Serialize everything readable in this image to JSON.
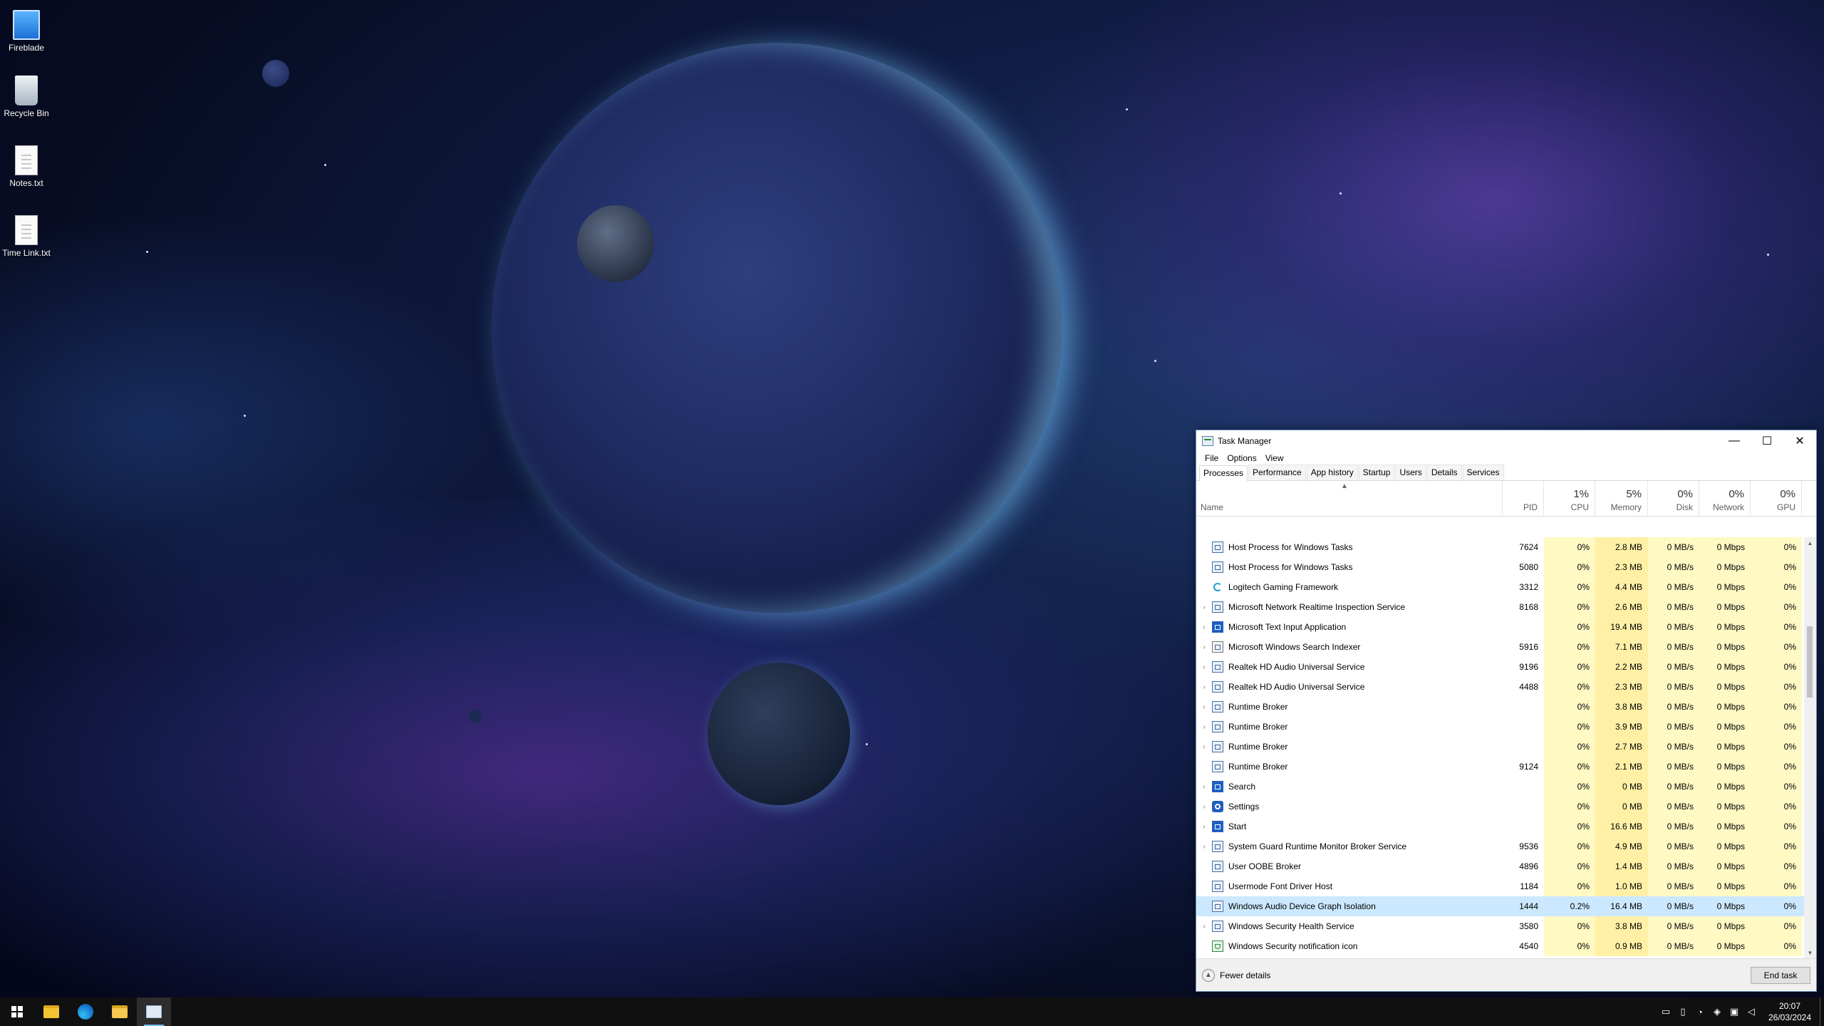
{
  "desktop": {
    "icons": [
      {
        "label": "Fireblade",
        "icon": "computer-icon"
      },
      {
        "label": "Recycle Bin",
        "icon": "recycle-bin-icon"
      },
      {
        "label": "Notes.txt",
        "icon": "text-file-icon"
      },
      {
        "label": "Time Link.txt",
        "icon": "text-file-icon"
      }
    ]
  },
  "task_manager": {
    "title": "Task Manager",
    "window_controls": {
      "minimize": "—",
      "maximize": "☐",
      "close": "✕"
    },
    "menu": [
      "File",
      "Options",
      "View"
    ],
    "tabs": [
      "Processes",
      "Performance",
      "App history",
      "Startup",
      "Users",
      "Details",
      "Services"
    ],
    "active_tab": "Processes",
    "columns": {
      "name": "Name",
      "pid": "PID",
      "cpu": {
        "label": "CPU",
        "total": "1%"
      },
      "memory": {
        "label": "Memory",
        "total": "5%"
      },
      "disk": {
        "label": "Disk",
        "total": "0%"
      },
      "network": {
        "label": "Network",
        "total": "0%"
      },
      "gpu": {
        "label": "GPU",
        "total": "0%"
      }
    },
    "rows": [
      {
        "name": "Host Process for Windows Tasks",
        "pid": "7624",
        "cpu": "0%",
        "memory": "2.8 MB",
        "disk": "0 MB/s",
        "network": "0 Mbps",
        "gpu": "0%",
        "expandable": false,
        "icon": "service-icon"
      },
      {
        "name": "Host Process for Windows Tasks",
        "pid": "5080",
        "cpu": "0%",
        "memory": "2.3 MB",
        "disk": "0 MB/s",
        "network": "0 Mbps",
        "gpu": "0%",
        "expandable": false,
        "icon": "service-icon"
      },
      {
        "name": "Logitech Gaming Framework",
        "pid": "3312",
        "cpu": "0%",
        "memory": "4.4 MB",
        "disk": "0 MB/s",
        "network": "0 Mbps",
        "gpu": "0%",
        "expandable": false,
        "icon": "logitech-icon"
      },
      {
        "name": "Microsoft Network Realtime Inspection Service",
        "pid": "8168",
        "cpu": "0%",
        "memory": "2.6 MB",
        "disk": "0 MB/s",
        "network": "0 Mbps",
        "gpu": "0%",
        "expandable": true,
        "icon": "service-icon"
      },
      {
        "name": "Microsoft Text Input Application",
        "pid": "",
        "cpu": "0%",
        "memory": "19.4 MB",
        "disk": "0 MB/s",
        "network": "0 Mbps",
        "gpu": "0%",
        "expandable": true,
        "icon": "app-icon"
      },
      {
        "name": "Microsoft Windows Search Indexer",
        "pid": "5916",
        "cpu": "0%",
        "memory": "7.1 MB",
        "disk": "0 MB/s",
        "network": "0 Mbps",
        "gpu": "0%",
        "expandable": true,
        "icon": "search-indexer-icon"
      },
      {
        "name": "Realtek HD Audio Universal Service",
        "pid": "9196",
        "cpu": "0%",
        "memory": "2.2 MB",
        "disk": "0 MB/s",
        "network": "0 Mbps",
        "gpu": "0%",
        "expandable": true,
        "icon": "service-icon"
      },
      {
        "name": "Realtek HD Audio Universal Service",
        "pid": "4488",
        "cpu": "0%",
        "memory": "2.3 MB",
        "disk": "0 MB/s",
        "network": "0 Mbps",
        "gpu": "0%",
        "expandable": true,
        "icon": "service-icon"
      },
      {
        "name": "Runtime Broker",
        "pid": "",
        "cpu": "0%",
        "memory": "3.8 MB",
        "disk": "0 MB/s",
        "network": "0 Mbps",
        "gpu": "0%",
        "expandable": true,
        "icon": "service-icon"
      },
      {
        "name": "Runtime Broker",
        "pid": "",
        "cpu": "0%",
        "memory": "3.9 MB",
        "disk": "0 MB/s",
        "network": "0 Mbps",
        "gpu": "0%",
        "expandable": true,
        "icon": "service-icon"
      },
      {
        "name": "Runtime Broker",
        "pid": "",
        "cpu": "0%",
        "memory": "2.7 MB",
        "disk": "0 MB/s",
        "network": "0 Mbps",
        "gpu": "0%",
        "expandable": true,
        "icon": "service-icon"
      },
      {
        "name": "Runtime Broker",
        "pid": "9124",
        "cpu": "0%",
        "memory": "2.1 MB",
        "disk": "0 MB/s",
        "network": "0 Mbps",
        "gpu": "0%",
        "expandable": false,
        "icon": "service-icon"
      },
      {
        "name": "Search",
        "pid": "",
        "cpu": "0%",
        "memory": "0 MB",
        "disk": "0 MB/s",
        "network": "0 Mbps",
        "gpu": "0%",
        "expandable": true,
        "icon": "search-icon"
      },
      {
        "name": "Settings",
        "pid": "",
        "cpu": "0%",
        "memory": "0 MB",
        "disk": "0 MB/s",
        "network": "0 Mbps",
        "gpu": "0%",
        "expandable": true,
        "icon": "gear-icon"
      },
      {
        "name": "Start",
        "pid": "",
        "cpu": "0%",
        "memory": "16.6 MB",
        "disk": "0 MB/s",
        "network": "0 Mbps",
        "gpu": "0%",
        "expandable": true,
        "icon": "start-icon"
      },
      {
        "name": "System Guard Runtime Monitor Broker Service",
        "pid": "9536",
        "cpu": "0%",
        "memory": "4.9 MB",
        "disk": "0 MB/s",
        "network": "0 Mbps",
        "gpu": "0%",
        "expandable": true,
        "icon": "service-icon"
      },
      {
        "name": "User OOBE Broker",
        "pid": "4896",
        "cpu": "0%",
        "memory": "1.4 MB",
        "disk": "0 MB/s",
        "network": "0 Mbps",
        "gpu": "0%",
        "expandable": false,
        "icon": "service-icon"
      },
      {
        "name": "Usermode Font Driver Host",
        "pid": "1184",
        "cpu": "0%",
        "memory": "1.0 MB",
        "disk": "0 MB/s",
        "network": "0 Mbps",
        "gpu": "0%",
        "expandable": false,
        "icon": "service-icon"
      },
      {
        "name": "Windows Audio Device Graph Isolation",
        "pid": "1444",
        "cpu": "0.2%",
        "memory": "16.4 MB",
        "disk": "0 MB/s",
        "network": "0 Mbps",
        "gpu": "0%",
        "expandable": false,
        "icon": "service-icon",
        "selected": true
      },
      {
        "name": "Windows Security Health Service",
        "pid": "3580",
        "cpu": "0%",
        "memory": "3.8 MB",
        "disk": "0 MB/s",
        "network": "0 Mbps",
        "gpu": "0%",
        "expandable": true,
        "icon": "service-icon"
      },
      {
        "name": "Windows Security notification icon",
        "pid": "4540",
        "cpu": "0%",
        "memory": "0.9 MB",
        "disk": "0 MB/s",
        "network": "0 Mbps",
        "gpu": "0%",
        "expandable": false,
        "icon": "shield-icon"
      }
    ],
    "footer": {
      "fewer_details": "Fewer details",
      "end_task": "End task"
    }
  },
  "taskbar": {
    "apps": [
      {
        "name": "start-button",
        "icon": "windows-logo-icon"
      },
      {
        "name": "file-manager-app",
        "icon": "folder-icon"
      },
      {
        "name": "edge-browser",
        "icon": "edge-icon"
      },
      {
        "name": "file-explorer",
        "icon": "folder-icon"
      },
      {
        "name": "task-manager-app",
        "icon": "task-manager-icon"
      }
    ],
    "clock": {
      "time": "20:07",
      "date": "26/03/2024"
    }
  }
}
